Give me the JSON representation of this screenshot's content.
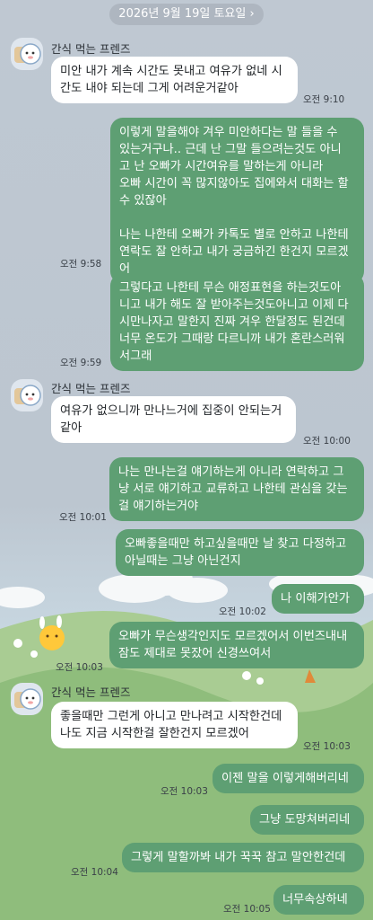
{
  "date_header": "2026년 9월 19일 토요일",
  "colors": {
    "out_bubble": "#5e9f73",
    "in_bubble": "#ffffff",
    "date_pill": "#aeb6c0"
  },
  "sender_name": "간식 먹는 프렌즈",
  "messages": [
    {
      "dir": "in",
      "lines": [
        "미안 내가 계속 시간도 못내고 여유가 없네 시",
        "간도 내야 되는데 그게 어려운거같아"
      ],
      "time": "오전 9:10"
    },
    {
      "dir": "out",
      "lines": [
        "이렇게 말을해야 겨우 미안하다는 말 들을 수",
        "있는거구나.. 근데 난 그말 들으려는것도 아니",
        "고 난 오빠가 시간여유를 말하는게 아니라",
        "오빠 시간이 꼭 많지않아도 집에와서 대화는 할",
        "수 있잖아",
        "",
        "나는 나한테 오빠가 카톡도 별로 안하고 나한테",
        "연락도 잘 안하고 내가 궁금하긴 한건지 모르겠",
        "어"
      ],
      "time": "오전 9:58"
    },
    {
      "dir": "out",
      "lines": [
        "그렇다고 나한테 무슨 애정표현을 하는것도아",
        "니고 내가 해도 잘 받아주는것도아니고 이제 다",
        "시만나자고 말한지 진짜 겨우 한달정도 된건데",
        "너무 온도가 그때랑 다르니까 내가 혼란스러워",
        "서그래"
      ],
      "time": "오전 9:59"
    },
    {
      "dir": "in",
      "lines": [
        "여유가 없으니까 만나느거에 집중이 안되는거",
        "같아"
      ],
      "time": "오전 10:00"
    },
    {
      "dir": "out",
      "lines": [
        "나는 만나는걸 얘기하는게 아니라 연락하고 그",
        "냥 서로 얘기하고 교류하고 나한테 관심을 갖는",
        "걸 얘기하는거야"
      ],
      "time": "오전 10:01"
    },
    {
      "dir": "out",
      "lines": [
        "오빠좋을때만 하고싶을때만 날 찾고 다정하고",
        "아닐때는 그냥 아닌건지"
      ],
      "time": ""
    },
    {
      "dir": "out",
      "lines": [
        "나 이해가안가"
      ],
      "time": "오전 10:02"
    },
    {
      "dir": "out",
      "lines": [
        "오빠가 무슨생각인지도 모르겠어서 이번즈내내",
        "잠도 제대로 못잤어 신경쓰여서"
      ],
      "time": "오전 10:03"
    },
    {
      "dir": "in",
      "lines": [
        "좋을때만 그런게 아니고 만나려고 시작한건데",
        "나도 지금 시작한걸 잘한건지 모르겠어"
      ],
      "time": "오전 10:03"
    },
    {
      "dir": "out",
      "lines": [
        "이젠 말을 이렇게해버리네"
      ],
      "time": "오전 10:03"
    },
    {
      "dir": "out",
      "lines": [
        "그냥 도망쳐버리네"
      ],
      "time": ""
    },
    {
      "dir": "out",
      "lines": [
        "그렇게 말할까봐 내가 꾹꾹 참고 말안한건데"
      ],
      "time": "오전 10:04"
    },
    {
      "dir": "out",
      "lines": [
        "너무속상하네"
      ],
      "time": "오전 10:05"
    }
  ]
}
